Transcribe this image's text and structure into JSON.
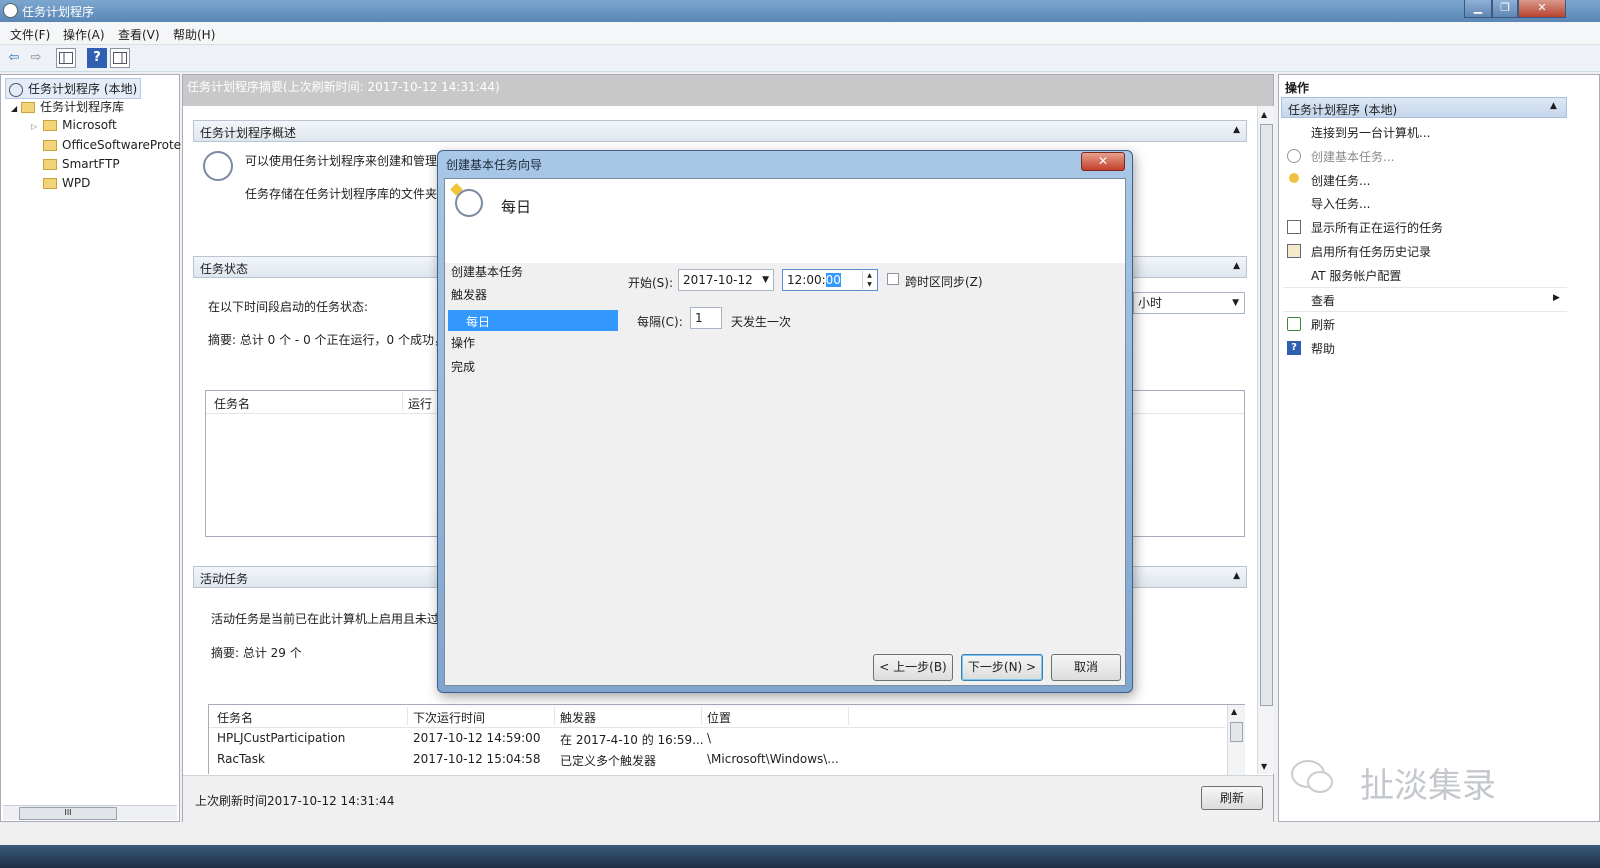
{
  "window": {
    "title": "任务计划程序",
    "min": "▁",
    "max": "❐",
    "close": "✕"
  },
  "menu": [
    "文件(F)",
    "操作(A)",
    "查看(V)",
    "帮助(H)"
  ],
  "toolbar": {
    "back": "⇦",
    "forward": "⇨",
    "help": "?"
  },
  "tree": {
    "root": "任务计划程序 (本地)",
    "library": "任务计划程序库",
    "folders": [
      "Microsoft",
      "OfficeSoftwareProte",
      "SmartFTP",
      "WPD"
    ],
    "scroll_mid": "III"
  },
  "center": {
    "summary_header": "任务计划程序摘要(上次刷新时间: 2017-10-12 14:31:44)",
    "overview": {
      "title": "任务计划程序概述",
      "line1": "可以使用任务计划程序来创建和管理",
      "line2": "任务存储在任务计划程序库的文件夹"
    },
    "status": {
      "title": "任务状态",
      "label": "在以下时间段启动的任务状态:",
      "period": "小时",
      "summary": "摘要: 总计 0 个 - 0 个正在运行，0 个成功，",
      "col_name": "任务名",
      "col_run": "运行"
    },
    "active": {
      "title": "活动任务",
      "desc": "活动任务是当前已在此计算机上启用且未过",
      "summary": "摘要: 总计 29 个",
      "columns": [
        "任务名",
        "下次运行时间",
        "触发器",
        "位置"
      ],
      "rows": [
        [
          "HPLJCustParticipation",
          "2017-10-12 14:59:00",
          "在 2017-4-10 的 16:59...",
          "\\"
        ],
        [
          "RacTask",
          "2017-10-12 15:04:58",
          "已定义多个触发器",
          "\\Microsoft\\Windows\\..."
        ]
      ]
    },
    "last_refresh": "上次刷新时间2017-10-12 14:31:44",
    "refresh_button": "刷新"
  },
  "actions": {
    "header": "操作",
    "group": "任务计划程序 (本地)",
    "items": [
      "连接到另一台计算机...",
      "创建基本任务...",
      "创建任务...",
      "导入任务...",
      "显示所有正在运行的任务",
      "启用所有任务历史记录",
      "AT 服务帐户配置",
      "查看",
      "刷新",
      "帮助"
    ]
  },
  "dialog": {
    "title": "创建基本任务向导",
    "close": "✕",
    "heading": "每日",
    "nav": [
      "创建基本任务",
      "触发器",
      "每日",
      "操作",
      "完成"
    ],
    "start_label": "开始(S):",
    "start_date": "2017-10-12",
    "start_time_plain": "12:00:",
    "start_time_sel": "00",
    "sync_label": "跨时区同步(Z)",
    "every_label": "每隔(C):",
    "every_value": "1",
    "every_unit": "天发生一次",
    "back_button": "< 上一步(B)",
    "next_button": "下一步(N) >",
    "cancel_button": "取消"
  },
  "watermark": "扯淡集录"
}
